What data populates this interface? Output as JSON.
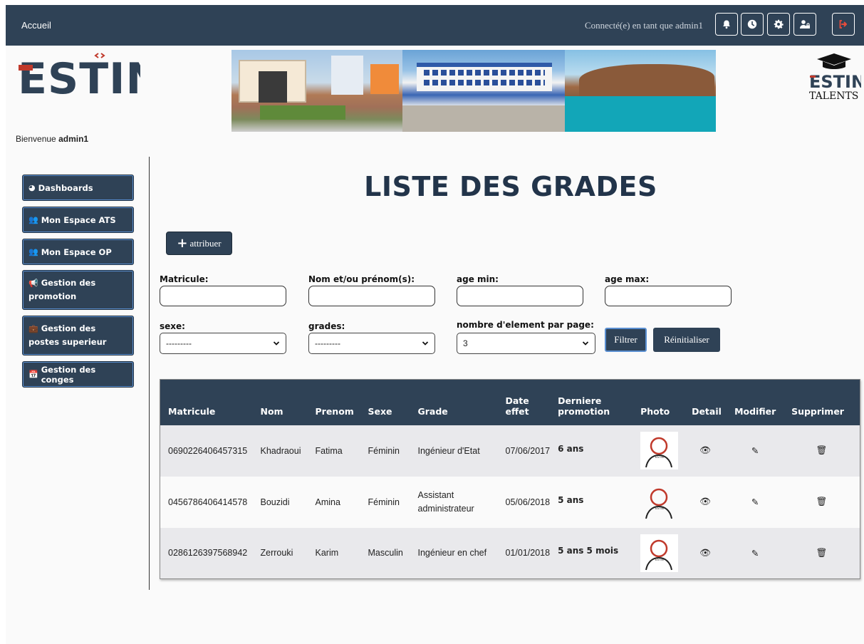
{
  "topbar": {
    "home": "Accueil",
    "connected": "Connecté(e) en tant que admin1",
    "icons": [
      "bell-icon",
      "clock-icon",
      "gear-icon",
      "user-lock-icon",
      "logout-icon"
    ]
  },
  "header": {
    "logo_text": "ESTIN",
    "talents_logo": "ESTIN",
    "talents_text": "TALENTS"
  },
  "welcome": {
    "prefix": "Bienvenue",
    "user": "admin1"
  },
  "sidebar": {
    "items": [
      {
        "label": "Dashboards",
        "icon": "pie-chart-icon"
      },
      {
        "label": "Mon Espace ATS",
        "icon": "users-icon"
      },
      {
        "label": "Mon Espace OP",
        "icon": "users-icon"
      },
      {
        "label": "Gestion des promotion",
        "icon": "megaphone-icon"
      },
      {
        "label": "Gestion des postes superieur",
        "icon": "briefcase-icon"
      },
      {
        "label": "Gestion des conges",
        "icon": "calendar-icon"
      }
    ]
  },
  "main": {
    "title": "LISTE DES GRADES",
    "attribuer": "attribuer",
    "filters": {
      "matricule": "Matricule:",
      "nom": "Nom et/ou prénom(s):",
      "age_min": "age min:",
      "age_max": "age max:",
      "sexe": "sexe:",
      "sexe_value": "---------",
      "grades": "grades:",
      "grades_value": "---------",
      "per_page": "nombre d'element par page:",
      "per_page_value": "3",
      "filtrer": "Filtrer",
      "reinit": "Réinitialiser"
    },
    "table": {
      "headers": [
        "Matricule",
        "Nom",
        "Prenom",
        "Sexe",
        "Grade",
        "Date effet",
        "Derniere promotion",
        "Photo",
        "Detail",
        "Modifier",
        "Supprimer"
      ],
      "rows": [
        {
          "matricule": "0690226406457315",
          "nom": "Khadraoui",
          "prenom": "Fatima",
          "sexe": "Féminin",
          "grade": "Ingénieur d'Etat",
          "date": "07/06/2017",
          "promo": "6 ans"
        },
        {
          "matricule": "0456786406414578",
          "nom": "Bouzidi",
          "prenom": "Amina",
          "sexe": "Féminin",
          "grade": "Assistant administrateur",
          "date": "05/06/2018",
          "promo": "5 ans"
        },
        {
          "matricule": "0286126397568942",
          "nom": "Zerrouki",
          "prenom": "Karim",
          "sexe": "Masculin",
          "grade": "Ingénieur en chef",
          "date": "01/01/2018",
          "promo": "5 ans 5 mois"
        }
      ]
    }
  },
  "colors": {
    "primary": "#2f4256",
    "title": "#22344a",
    "row_alt": "#e9e9ec",
    "logo_red": "#c0392b"
  }
}
